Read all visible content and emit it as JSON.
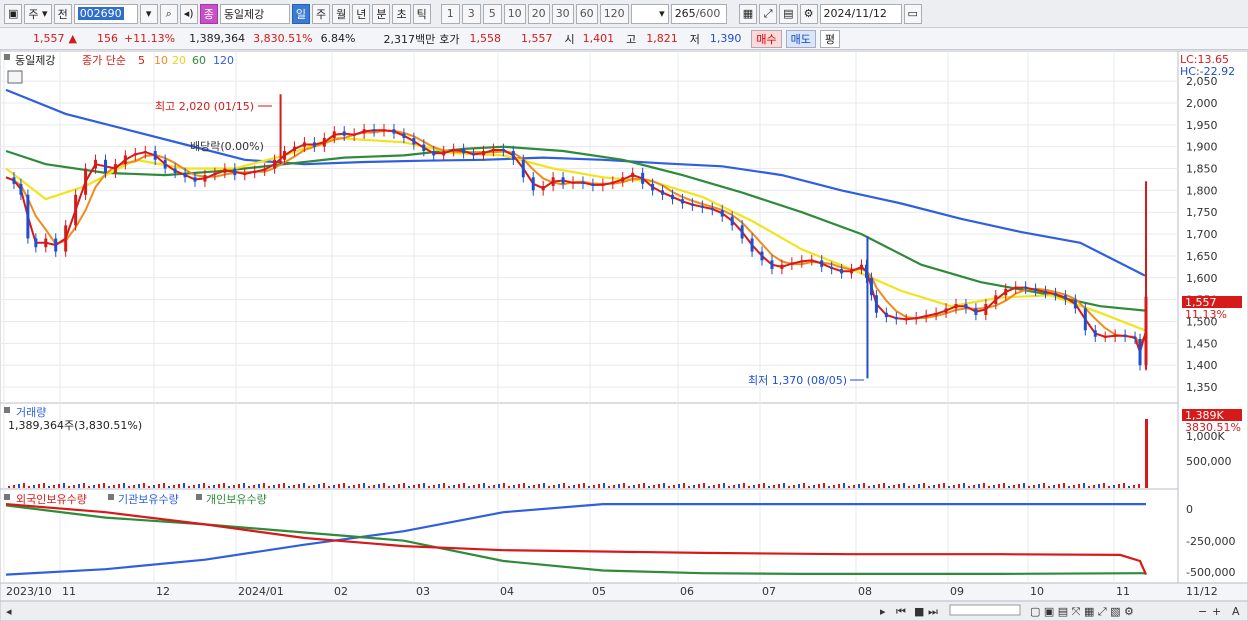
{
  "toolbar": {
    "market": "주",
    "prev": "전",
    "code": "002690",
    "stock_badge": "종",
    "stock_name": "동일제강",
    "periods": [
      "일",
      "주",
      "월",
      "년",
      "분",
      "초",
      "틱"
    ],
    "numbers": [
      "1",
      "3",
      "5",
      "10",
      "20",
      "30",
      "60",
      "120"
    ],
    "count": "265",
    "count_total": "/600",
    "date": "2024/11/12"
  },
  "quote": {
    "price": "1,557",
    "up_arrow": "▲",
    "change": "156",
    "change_pct": "+11.13%",
    "volume": "1,389,364",
    "volume_ratio": "3,830.51%",
    "turnover": "6.84%",
    "amount": "2,317백만",
    "bid_label": "호가",
    "bid1": "1,558",
    "bid2": "1,557",
    "open_label": "시",
    "open": "1,401",
    "high_label": "고",
    "high": "1,821",
    "low_label": "저",
    "low": "1,390",
    "buy_label": "매수",
    "sell_label": "매도",
    "eval_label": "평"
  },
  "legend": {
    "name": "동일제강",
    "title": "종가 단순",
    "ma5": "5",
    "ma10": "10",
    "ma20": "20",
    "ma60": "60",
    "ma120": "120",
    "colors": {
      "ma5": "#d61a1a",
      "ma10": "#f08a1a",
      "ma20": "#e6d51a",
      "ma60": "#2e8b3a",
      "ma120": "#2f5fe0"
    }
  },
  "annotations": {
    "high": "최고 2,020 (01/15)",
    "low": "최저 1,370 (08/05)",
    "dividend": "배당락(0.00%)",
    "lc": "LC:13.65",
    "hc": "HC:-22.92",
    "price_tag": "1,557",
    "price_tag_pct": "11.13%"
  },
  "volume_panel": {
    "title": "거래량",
    "value": "1,389,364주(3,830.51%)",
    "tag": "1,389K",
    "tag_pct": "3830.51%",
    "ticks": [
      "1,000K",
      "500,000"
    ]
  },
  "holdings_panel": {
    "foreign": "외국인보유수량",
    "institution": "기관보유수량",
    "individual": "개인보유수량",
    "ticks": [
      "0",
      "-250,000",
      "-500,000"
    ]
  },
  "x_axis": {
    "labels": [
      "2023/10",
      "11",
      "12",
      "2024/01",
      "02",
      "03",
      "04",
      "05",
      "06",
      "07",
      "08",
      "09",
      "10",
      "11",
      "11/12"
    ]
  },
  "chart_data": {
    "type": "candlestick",
    "y_ticks": [
      2050,
      2000,
      1950,
      1900,
      1850,
      1800,
      1750,
      1700,
      1650,
      1600,
      1550,
      1500,
      1450,
      1400,
      1350
    ],
    "ylim": [
      1325,
      2080
    ],
    "close_path": [
      [
        0,
        1830
      ],
      [
        8,
        1815
      ],
      [
        15,
        1790
      ],
      [
        22,
        1690
      ],
      [
        30,
        1670
      ],
      [
        40,
        1690
      ],
      [
        50,
        1660
      ],
      [
        60,
        1720
      ],
      [
        70,
        1790
      ],
      [
        80,
        1850
      ],
      [
        90,
        1870
      ],
      [
        100,
        1840
      ],
      [
        110,
        1860
      ],
      [
        120,
        1880
      ],
      [
        130,
        1885
      ],
      [
        140,
        1890
      ],
      [
        150,
        1870
      ],
      [
        160,
        1850
      ],
      [
        170,
        1840
      ],
      [
        180,
        1830
      ],
      [
        190,
        1820
      ],
      [
        200,
        1835
      ],
      [
        210,
        1840
      ],
      [
        220,
        1850
      ],
      [
        230,
        1835
      ],
      [
        240,
        1840
      ],
      [
        250,
        1845
      ],
      [
        260,
        1850
      ],
      [
        270,
        1870
      ],
      [
        280,
        1890
      ],
      [
        290,
        1900
      ],
      [
        300,
        1910
      ],
      [
        310,
        1900
      ],
      [
        320,
        1920
      ],
      [
        330,
        1935
      ],
      [
        340,
        1925
      ],
      [
        350,
        1930
      ],
      [
        360,
        1940
      ],
      [
        370,
        1935
      ],
      [
        380,
        1940
      ],
      [
        390,
        1930
      ],
      [
        400,
        1920
      ],
      [
        410,
        1905
      ],
      [
        420,
        1890
      ],
      [
        430,
        1880
      ],
      [
        440,
        1890
      ],
      [
        450,
        1895
      ],
      [
        460,
        1885
      ],
      [
        470,
        1880
      ],
      [
        480,
        1890
      ],
      [
        490,
        1895
      ],
      [
        500,
        1890
      ],
      [
        510,
        1870
      ],
      [
        520,
        1830
      ],
      [
        530,
        1800
      ],
      [
        540,
        1810
      ],
      [
        550,
        1830
      ],
      [
        560,
        1815
      ],
      [
        570,
        1820
      ],
      [
        580,
        1815
      ],
      [
        590,
        1810
      ],
      [
        600,
        1815
      ],
      [
        610,
        1820
      ],
      [
        620,
        1830
      ],
      [
        630,
        1840
      ],
      [
        640,
        1815
      ],
      [
        650,
        1800
      ],
      [
        660,
        1790
      ],
      [
        670,
        1780
      ],
      [
        680,
        1770
      ],
      [
        690,
        1765
      ],
      [
        700,
        1760
      ],
      [
        710,
        1755
      ],
      [
        720,
        1740
      ],
      [
        730,
        1720
      ],
      [
        740,
        1690
      ],
      [
        750,
        1660
      ],
      [
        760,
        1640
      ],
      [
        770,
        1620
      ],
      [
        780,
        1630
      ],
      [
        790,
        1635
      ],
      [
        800,
        1640
      ],
      [
        810,
        1640
      ],
      [
        820,
        1625
      ],
      [
        830,
        1620
      ],
      [
        840,
        1610
      ],
      [
        850,
        1620
      ],
      [
        860,
        1630
      ],
      [
        865,
        1600
      ],
      [
        870,
        1560
      ],
      [
        875,
        1520
      ],
      [
        885,
        1510
      ],
      [
        895,
        1505
      ],
      [
        905,
        1505
      ],
      [
        915,
        1510
      ],
      [
        925,
        1515
      ],
      [
        935,
        1520
      ],
      [
        945,
        1530
      ],
      [
        955,
        1540
      ],
      [
        965,
        1530
      ],
      [
        975,
        1515
      ],
      [
        985,
        1540
      ],
      [
        995,
        1560
      ],
      [
        1005,
        1575
      ],
      [
        1015,
        1580
      ],
      [
        1025,
        1575
      ],
      [
        1035,
        1570
      ],
      [
        1045,
        1565
      ],
      [
        1055,
        1560
      ],
      [
        1065,
        1550
      ],
      [
        1075,
        1530
      ],
      [
        1085,
        1480
      ],
      [
        1095,
        1465
      ],
      [
        1105,
        1465
      ],
      [
        1115,
        1470
      ],
      [
        1125,
        1465
      ],
      [
        1135,
        1460
      ],
      [
        1140,
        1400
      ],
      [
        1146,
        1557
      ]
    ],
    "ma20": [
      [
        0,
        1850
      ],
      [
        40,
        1780
      ],
      [
        80,
        1810
      ],
      [
        130,
        1870
      ],
      [
        180,
        1850
      ],
      [
        230,
        1850
      ],
      [
        280,
        1880
      ],
      [
        330,
        1920
      ],
      [
        400,
        1910
      ],
      [
        450,
        1885
      ],
      [
        500,
        1880
      ],
      [
        550,
        1850
      ],
      [
        600,
        1830
      ],
      [
        650,
        1820
      ],
      [
        700,
        1785
      ],
      [
        750,
        1730
      ],
      [
        800,
        1665
      ],
      [
        850,
        1620
      ],
      [
        900,
        1570
      ],
      [
        950,
        1535
      ],
      [
        1000,
        1555
      ],
      [
        1050,
        1560
      ],
      [
        1100,
        1520
      ],
      [
        1145,
        1480
      ]
    ],
    "ma60": [
      [
        0,
        1890
      ],
      [
        40,
        1860
      ],
      [
        100,
        1840
      ],
      [
        160,
        1835
      ],
      [
        220,
        1845
      ],
      [
        280,
        1860
      ],
      [
        340,
        1875
      ],
      [
        400,
        1880
      ],
      [
        460,
        1895
      ],
      [
        500,
        1900
      ],
      [
        560,
        1890
      ],
      [
        620,
        1870
      ],
      [
        680,
        1835
      ],
      [
        740,
        1795
      ],
      [
        800,
        1750
      ],
      [
        860,
        1700
      ],
      [
        920,
        1630
      ],
      [
        980,
        1590
      ],
      [
        1040,
        1565
      ],
      [
        1100,
        1535
      ],
      [
        1145,
        1525
      ]
    ],
    "ma120": [
      [
        0,
        2030
      ],
      [
        60,
        1975
      ],
      [
        120,
        1940
      ],
      [
        180,
        1905
      ],
      [
        240,
        1870
      ],
      [
        300,
        1860
      ],
      [
        360,
        1865
      ],
      [
        420,
        1868
      ],
      [
        480,
        1870
      ],
      [
        540,
        1875
      ],
      [
        600,
        1870
      ],
      [
        660,
        1862
      ],
      [
        720,
        1855
      ],
      [
        780,
        1835
      ],
      [
        840,
        1800
      ],
      [
        900,
        1770
      ],
      [
        960,
        1735
      ],
      [
        1020,
        1705
      ],
      [
        1080,
        1680
      ],
      [
        1145,
        1605
      ]
    ],
    "volume_spike": 1389364,
    "volume_ylim": [
      0,
      1450000
    ],
    "holdings": {
      "ylim": [
        -560000,
        30000
      ],
      "foreign": [
        [
          0,
          0
        ],
        [
          100,
          -60000
        ],
        [
          200,
          -150000
        ],
        [
          300,
          -250000
        ],
        [
          400,
          -310000
        ],
        [
          500,
          -340000
        ],
        [
          600,
          -350000
        ],
        [
          700,
          -360000
        ],
        [
          850,
          -370000
        ],
        [
          1000,
          -370000
        ],
        [
          1120,
          -375000
        ],
        [
          1140,
          -420000
        ],
        [
          1146,
          -520000
        ]
      ],
      "institution": [
        [
          0,
          -520000
        ],
        [
          100,
          -480000
        ],
        [
          200,
          -410000
        ],
        [
          300,
          -300000
        ],
        [
          400,
          -200000
        ],
        [
          500,
          -60000
        ],
        [
          600,
          0
        ],
        [
          800,
          0
        ],
        [
          1000,
          0
        ],
        [
          1146,
          0
        ]
      ],
      "individual": [
        [
          0,
          -10000
        ],
        [
          100,
          -100000
        ],
        [
          200,
          -150000
        ],
        [
          300,
          -210000
        ],
        [
          400,
          -270000
        ],
        [
          500,
          -420000
        ],
        [
          600,
          -490000
        ],
        [
          700,
          -510000
        ],
        [
          800,
          -515000
        ],
        [
          1000,
          -515000
        ],
        [
          1146,
          -510000
        ]
      ]
    }
  }
}
